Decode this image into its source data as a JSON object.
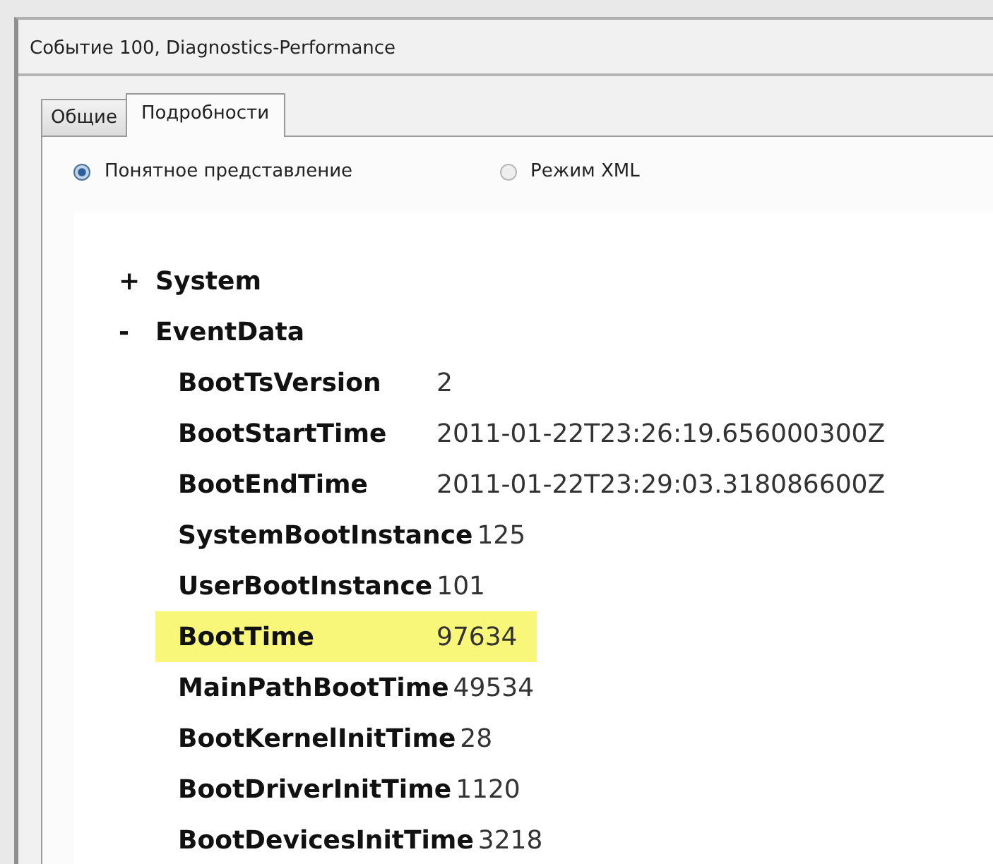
{
  "window": {
    "title": "Событие 100, Diagnostics-Performance"
  },
  "tabs": [
    {
      "label": "Общие",
      "selected": false
    },
    {
      "label": "Подробности",
      "selected": true
    }
  ],
  "view_modes": [
    {
      "label": "Понятное представление",
      "selected": true
    },
    {
      "label": "Режим XML",
      "selected": false
    }
  ],
  "tree": [
    {
      "toggle": "+",
      "label": "System"
    },
    {
      "toggle": "-",
      "label": "EventData",
      "children": [
        {
          "name": "BootTsVersion",
          "value": "2",
          "highlighted": false
        },
        {
          "name": "BootStartTime",
          "value": "2011-01-22T23:26:19.656000300Z",
          "highlighted": false
        },
        {
          "name": "BootEndTime",
          "value": "2011-01-22T23:29:03.318086600Z",
          "highlighted": false
        },
        {
          "name": "SystemBootInstance",
          "value": "125",
          "highlighted": false
        },
        {
          "name": "UserBootInstance",
          "value": "101",
          "highlighted": false
        },
        {
          "name": "BootTime",
          "value": "97634",
          "highlighted": true
        },
        {
          "name": "MainPathBootTime",
          "value": "49534",
          "highlighted": false
        },
        {
          "name": "BootKernelInitTime",
          "value": "28",
          "highlighted": false
        },
        {
          "name": "BootDriverInitTime",
          "value": "1120",
          "highlighted": false
        },
        {
          "name": "BootDevicesInitTime",
          "value": "3218",
          "highlighted": false
        }
      ]
    }
  ]
}
